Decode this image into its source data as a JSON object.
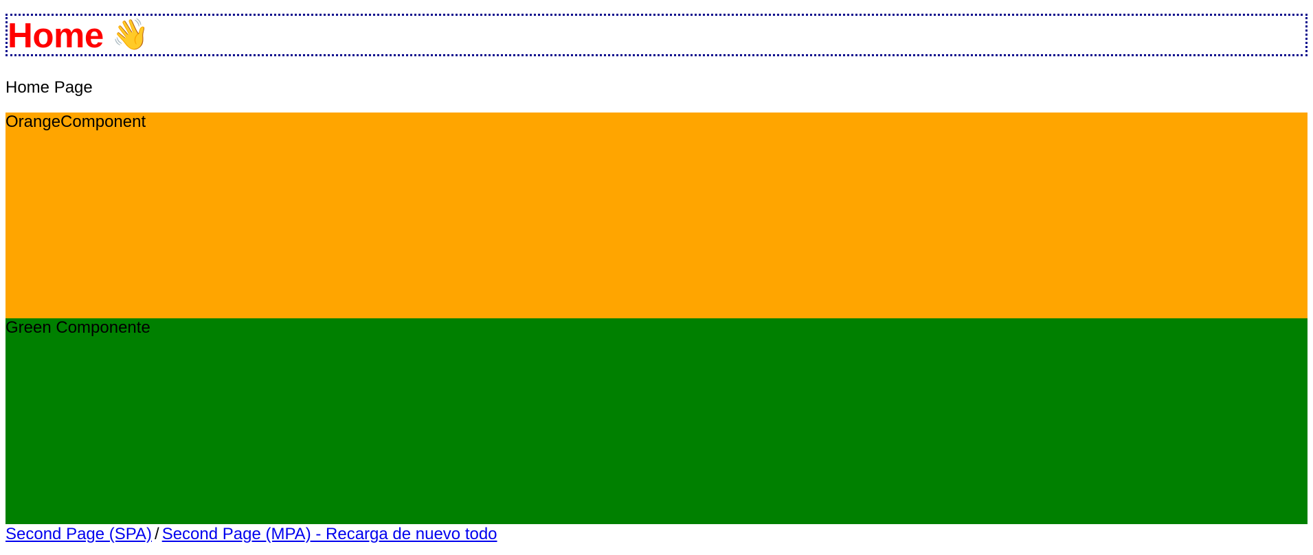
{
  "header": {
    "title": "Home",
    "emoji": "👋"
  },
  "subtitle": "Home Page",
  "orange_component": {
    "label": "OrangeComponent",
    "color": "#ffa500"
  },
  "green_component": {
    "label": "Green Componente",
    "color": "#008000"
  },
  "links": {
    "spa_label": "Second Page (SPA)",
    "separator": "/",
    "mpa_label": "Second Page (MPA) - Recarga de nuevo todo"
  },
  "colors": {
    "title": "#ff0000",
    "title_border": "#00008b",
    "link": "#0000ee"
  }
}
